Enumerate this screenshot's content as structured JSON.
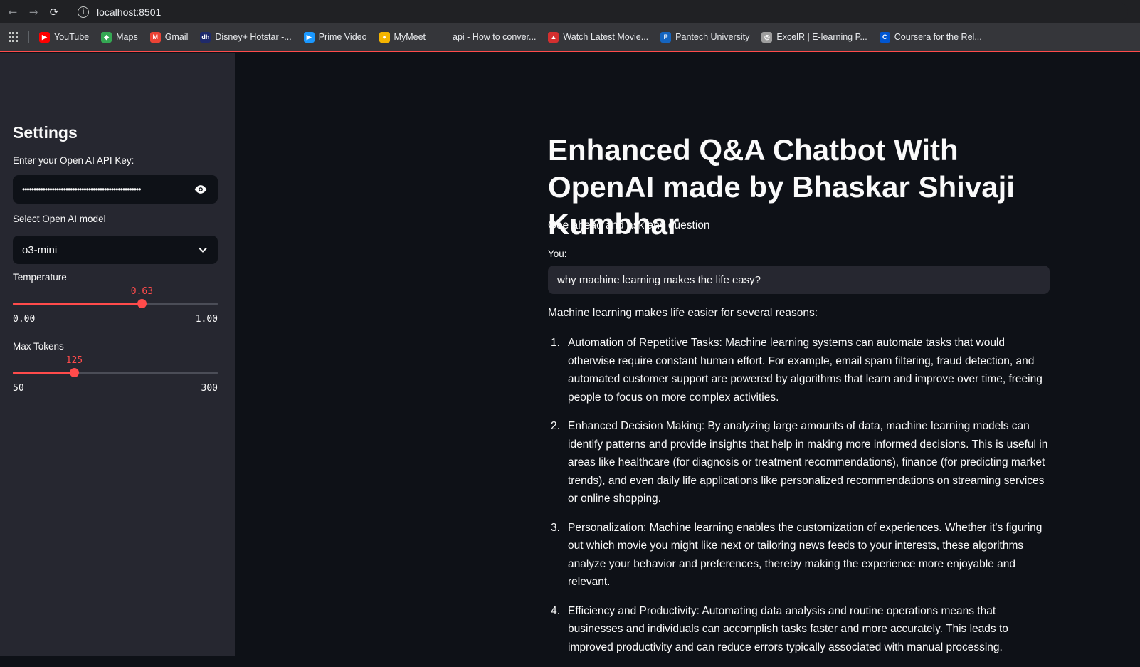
{
  "browser": {
    "url": "localhost:8501",
    "bookmarks": [
      {
        "label": "YouTube",
        "icon": "youtube-icon",
        "color": "#ff0000"
      },
      {
        "label": "Maps",
        "icon": "maps-icon",
        "color": "#34a853"
      },
      {
        "label": "Gmail",
        "icon": "gmail-icon",
        "color": "#ea4335"
      },
      {
        "label": "Disney+ Hotstar -...",
        "icon": "hotstar-icon",
        "color": "#1f2a6b"
      },
      {
        "label": "Prime Video",
        "icon": "prime-video-icon",
        "color": "#1a98ff"
      },
      {
        "label": "MyMeet",
        "icon": "mymeet-icon",
        "color": "#f4b400"
      },
      {
        "label": "api - How to conver...",
        "icon": "stackoverflow-icon",
        "color": "#35363a"
      },
      {
        "label": "Watch Latest Movie...",
        "icon": "movie-site-icon",
        "color": "#d32f2f"
      },
      {
        "label": "Pantech University",
        "icon": "pantech-icon",
        "color": "#1565c0"
      },
      {
        "label": "ExcelR | E-learning P...",
        "icon": "excelr-icon",
        "color": "#9e9e9e"
      },
      {
        "label": "Coursera for the Rel...",
        "icon": "coursera-icon",
        "color": "#0056d2"
      }
    ]
  },
  "sidebar": {
    "title": "Settings",
    "api_key_label": "Enter your Open AI API Key:",
    "api_key_value": "••••••••••••••••••••••••••••••••••••••••••••••••••••",
    "model_label": "Select Open AI model",
    "model_value": "o3-mini",
    "temperature": {
      "label": "Temperature",
      "value": "0.63",
      "min": "0.00",
      "max": "1.00",
      "fraction": 0.63
    },
    "max_tokens": {
      "label": "Max Tokens",
      "value": "125",
      "min": "50",
      "max": "300",
      "fraction": 0.3
    }
  },
  "main": {
    "title": "Enhanced Q&A Chatbot With OpenAI made by Bhaskar Shivaji Kumbhar",
    "subtitle": "Goe ahead and ask any question",
    "you_label": "You:",
    "question": "why machine learning makes the life easy?",
    "answer_intro": "Machine learning makes life easier for several reasons:",
    "answer_items": [
      {
        "num": "1.",
        "text": "Automation of Repetitive Tasks: Machine learning systems can automate tasks that would otherwise require constant human effort. For example, email spam filtering, fraud detection, and automated customer support are powered by algorithms that learn and improve over time, freeing people to focus on more complex activities."
      },
      {
        "num": "2.",
        "text": "Enhanced Decision Making: By analyzing large amounts of data, machine learning models can identify patterns and provide insights that help in making more informed decisions. This is useful in areas like healthcare (for diagnosis or treatment recommendations), finance (for predicting market trends), and even daily life applications like personalized recommendations on streaming services or online shopping."
      },
      {
        "num": "3.",
        "text": "Personalization: Machine learning enables the customization of experiences. Whether it's figuring out which movie you might like next or tailoring news feeds to your interests, these algorithms analyze your behavior and preferences, thereby making the experience more enjoyable and relevant."
      },
      {
        "num": "4.",
        "text": "Efficiency and Productivity: Automating data analysis and routine operations means that businesses and individuals can accomplish tasks faster and more accurately. This leads to improved productivity and can reduce errors typically associated with manual processing."
      }
    ]
  },
  "colors": {
    "accent": "#ff4b4b",
    "sidebar_bg": "#262730",
    "main_bg": "#0e1117"
  }
}
